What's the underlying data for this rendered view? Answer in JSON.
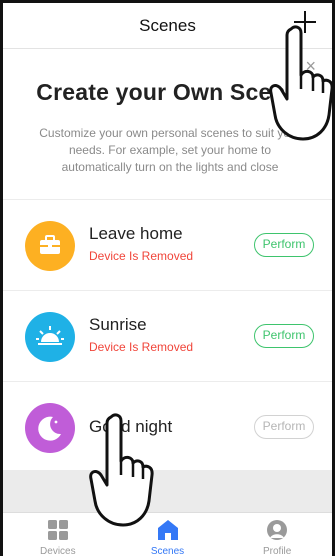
{
  "header": {
    "title": "Scenes",
    "add_icon": "plus-icon"
  },
  "promo": {
    "title": "Create your Own Scene",
    "description": "Customize your own personal scenes to suit your needs. For example, set your home to automatically turn on the lights and close",
    "close_icon": "close-icon"
  },
  "scenes": [
    {
      "name": "Leave home",
      "status": "Device Is Removed",
      "action": "Perform",
      "icon": "briefcase-icon",
      "color": "#fdb022"
    },
    {
      "name": "Sunrise",
      "status": "Device Is Removed",
      "action": "Perform",
      "icon": "sunrise-icon",
      "color": "#1fb1e6"
    },
    {
      "name": "Good night",
      "status": "",
      "action": "Perform",
      "icon": "moon-icon",
      "color": "#c05dd8"
    }
  ],
  "tabbar": {
    "items": [
      {
        "label": "Devices",
        "icon": "grid-icon",
        "active": false
      },
      {
        "label": "Scenes",
        "icon": "home-icon",
        "active": true
      },
      {
        "label": "Profile",
        "icon": "person-icon",
        "active": false
      }
    ]
  },
  "colors": {
    "accent": "#3478f6",
    "perform": "#3ec46d",
    "error": "#f0453a"
  }
}
